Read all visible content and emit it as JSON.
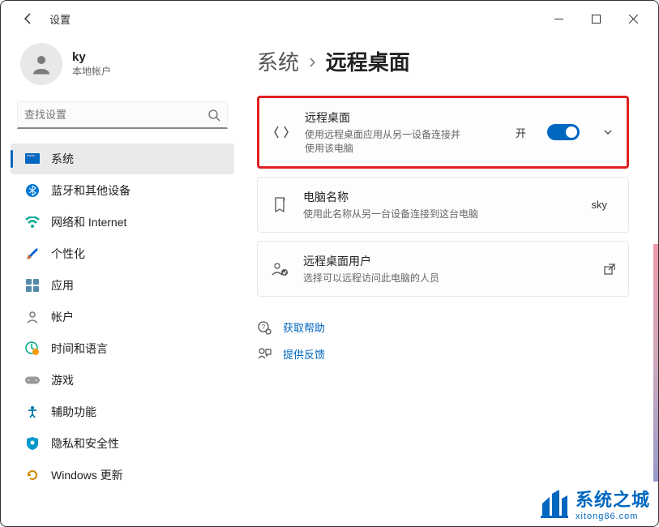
{
  "titlebar": {
    "app_title": "设置"
  },
  "user": {
    "name": "ky",
    "subtitle": "本地帐户"
  },
  "search": {
    "placeholder": "查找设置"
  },
  "nav": {
    "items": [
      {
        "label": "系统"
      },
      {
        "label": "蓝牙和其他设备"
      },
      {
        "label": "网络和 Internet"
      },
      {
        "label": "个性化"
      },
      {
        "label": "应用"
      },
      {
        "label": "帐户"
      },
      {
        "label": "时间和语言"
      },
      {
        "label": "游戏"
      },
      {
        "label": "辅助功能"
      },
      {
        "label": "隐私和安全性"
      },
      {
        "label": "Windows 更新"
      }
    ]
  },
  "breadcrumb": {
    "root": "系统",
    "current": "远程桌面"
  },
  "cards": {
    "remote": {
      "title": "远程桌面",
      "desc": "使用远程桌面应用从另一设备连接并使用该电脑",
      "toggle_label": "开"
    },
    "pcname": {
      "title": "电脑名称",
      "desc": "使用此名称从另一台设备连接到这台电脑",
      "value": "sky"
    },
    "users": {
      "title": "远程桌面用户",
      "desc": "选择可以远程访问此电脑的人员"
    }
  },
  "help": {
    "get_help": "获取帮助",
    "feedback": "提供反馈"
  },
  "watermark": {
    "title": "系统之城",
    "sub": "xitong86.com"
  }
}
